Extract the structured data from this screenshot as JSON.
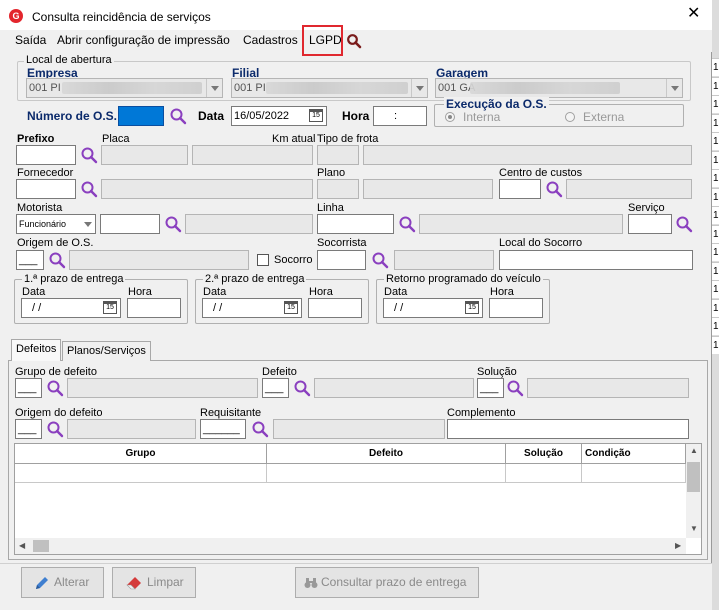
{
  "window": {
    "title": "Consulta reincidência de serviços",
    "app_icon_letter": "G"
  },
  "menu": [
    "Saída",
    "Abrir configuração de impressão",
    "Cadastros",
    "LGPD"
  ],
  "local": {
    "group_title": "Local de abertura",
    "empresa_label": "Empresa",
    "empresa_value": "001 PI",
    "filial_label": "Filial",
    "filial_value": "001 PI",
    "garagem_label": "Garagem",
    "garagem_value": "001 GA"
  },
  "os": {
    "numero_label": "Número de O.S.",
    "data_label": "Data",
    "data_value": "16/05/2022",
    "hora_label": "Hora",
    "hora_value": ":",
    "execucao_title": "Execução da O.S.",
    "interna_label": "Interna",
    "externa_label": "Externa"
  },
  "fields": {
    "prefixo": "Prefixo",
    "placa": "Placa",
    "km_atual": "Km atual",
    "tipo_frota": "Tipo de frota",
    "fornecedor": "Fornecedor",
    "plano": "Plano",
    "centro_custos": "Centro de custos",
    "motorista": "Motorista",
    "motorista_select": "Funcionário",
    "linha": "Linha",
    "servico": "Serviço",
    "origem_os": "Origem de O.S.",
    "origem_os_value": "___",
    "socorro": "Socorro",
    "socorrista": "Socorrista",
    "local_socorro": "Local do Socorro"
  },
  "prazos": [
    {
      "title": "1.ª prazo de entrega",
      "data_label": "Data",
      "hora_label": "Hora",
      "data_value": " / /"
    },
    {
      "title": "2.ª prazo de entrega",
      "data_label": "Data",
      "hora_label": "Hora",
      "data_value": " / /"
    },
    {
      "title": "Retorno programado do veículo",
      "data_label": "Data",
      "hora_label": "Hora",
      "data_value": " / /"
    }
  ],
  "tabs": [
    "Defeitos",
    "Planos/Serviços"
  ],
  "defeitos": {
    "grupo": "Grupo de defeito",
    "grupo_value": "___",
    "defeito": "Defeito",
    "defeito_value": "___",
    "solucao": "Solução",
    "solucao_value": "___",
    "origem": "Origem do defeito",
    "origem_value": "___",
    "requisitante": "Requisitante",
    "requisitante_value": "______",
    "complemento": "Complemento"
  },
  "grid": {
    "columns": [
      "Grupo",
      "Defeito",
      "Solução",
      "Condição"
    ]
  },
  "buttons": {
    "alterar": "Alterar",
    "limpar": "Limpar",
    "consultar": "Consultar prazo de entrega"
  },
  "right_strip": [
    "1",
    "1",
    "1",
    "1",
    "1",
    "1",
    "1",
    "1",
    "1",
    "1",
    "1",
    "1",
    "1",
    "1",
    "1",
    "1"
  ],
  "colors": {
    "accent_blue": "#0b2a6b",
    "highlight_red": "#e0282f",
    "selection_blue": "#0078d7",
    "magnifier": "#8a3fbf"
  }
}
